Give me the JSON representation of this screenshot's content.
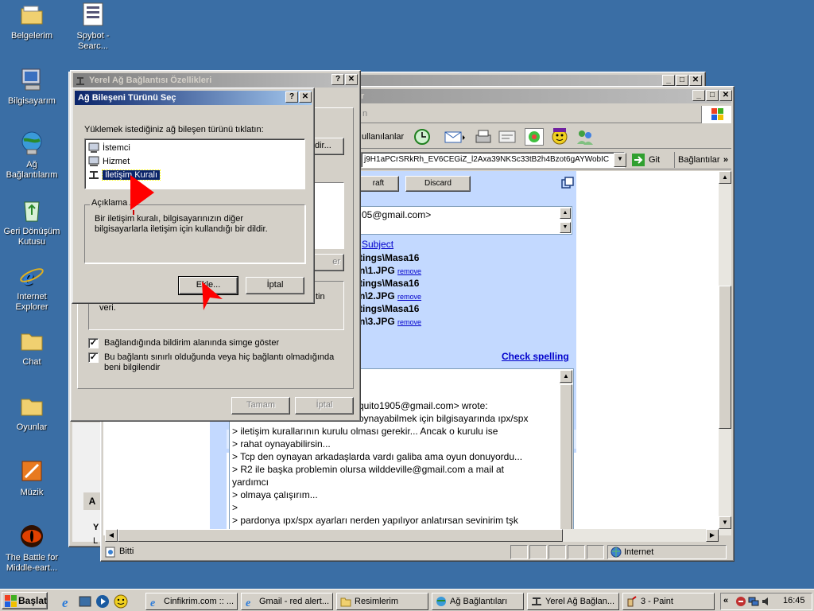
{
  "desktop": {
    "icons": [
      {
        "label": "Belgelerim"
      },
      {
        "label": "Spybot - Searc..."
      },
      {
        "label": "Bilgisayarım"
      },
      {
        "label": "Ağ Bağlantılarım"
      },
      {
        "label": "Geri Dönüşüm Kutusu"
      },
      {
        "label": "Internet Explorer"
      },
      {
        "label": "Chat"
      },
      {
        "label": "Oyunlar"
      },
      {
        "label": "Müzik"
      },
      {
        "label": "The Battle for Middle-eart..."
      }
    ]
  },
  "browser": {
    "title_suffix": "r",
    "title_suffix2": "n",
    "toolbar_label": "ullanılanlar",
    "address": "j9H1aPCrSRkRh_EV6CEGiZ_l2Axa39NKSc33tB2h4Bzot6gAYWobIC",
    "go_label": "Git",
    "links_label": "Bağlantılar",
    "draft_button": "raft",
    "discard_button": "Discard",
    "to_value": "05@gmail.com>",
    "subject_link": "Subject",
    "attachments": [
      {
        "line1": "tings\\Masa16",
        "line2": "n\\1.JPG"
      },
      {
        "line1": "tings\\Masa16",
        "line2": "n\\2.JPG"
      },
      {
        "line1": "tings\\Masa16",
        "line2": "n\\3.JPG"
      }
    ],
    "remove_label": "remove",
    "check_spelling": "Check spelling",
    "body_lines": [
      "quito1905@gmail.com> wrote:",
      "oynayabilmek için bilgisayarında ıpx/spx",
      "> iletişim kurallarının kurulu olması gerekir... Ancak o kurulu ise",
      "> rahat oynayabilirsin...",
      "> Tcp den oynayan arkadaşlarda vardı galiba ama oyun donuyordu...",
      "> R2 ile başka problemin olursa wilddeville@gmail.com a mail at",
      "yardımcı",
      "> olmaya çalışırım...",
      ">",
      "> pardonya ıpx/spx ayarları nerden yapılıyor anlatırsan sevinirim tşk"
    ],
    "status_left": "Bitti",
    "status_zone": "Internet"
  },
  "props_dialog": {
    "title": "Yerel Ağ Bağlantısı Özellikleri",
    "button_partial": "dir...",
    "button_partial2": "er",
    "partial_text": "tin",
    "partial_text2": "veri.",
    "check1": "Bağlandığında bildirim alanında simge göster",
    "check2": "Bu bağlantı sınırlı olduğunda veya hiç bağlantı olmadığında beni bilgilendir",
    "ok": "Tamam",
    "cancel": "İptal"
  },
  "component_dialog": {
    "title": "Ağ Bileşeni Türünü Seç",
    "prompt": "Yüklemek istediğiniz ağ bileşen türünü tıklatın:",
    "items": [
      {
        "label": "İstemci"
      },
      {
        "label": "Hizmet"
      },
      {
        "label": "İletişim Kuralı"
      }
    ],
    "description_label": "Açıklama",
    "description_text": "Bir iletişim kuralı, bilgisayarınızın diğer bilgisayarlarla iletişim için kullandığı bir dildir.",
    "add_button": "Ekle...",
    "cancel_button": "İptal"
  },
  "bg_window": {
    "partial_a": "A",
    "partial_y": "Y",
    "partial_l": "L"
  },
  "taskbar": {
    "start": "Başlat",
    "tasks": [
      {
        "label": "Cinfikrim.com :: ..."
      },
      {
        "label": "Gmail - red alert..."
      },
      {
        "label": "Resimlerim"
      },
      {
        "label": "Ağ Bağlantıları"
      },
      {
        "label": "Yerel Ağ Bağlan..."
      },
      {
        "label": "3 - Paint"
      }
    ],
    "clock": "16:45"
  }
}
